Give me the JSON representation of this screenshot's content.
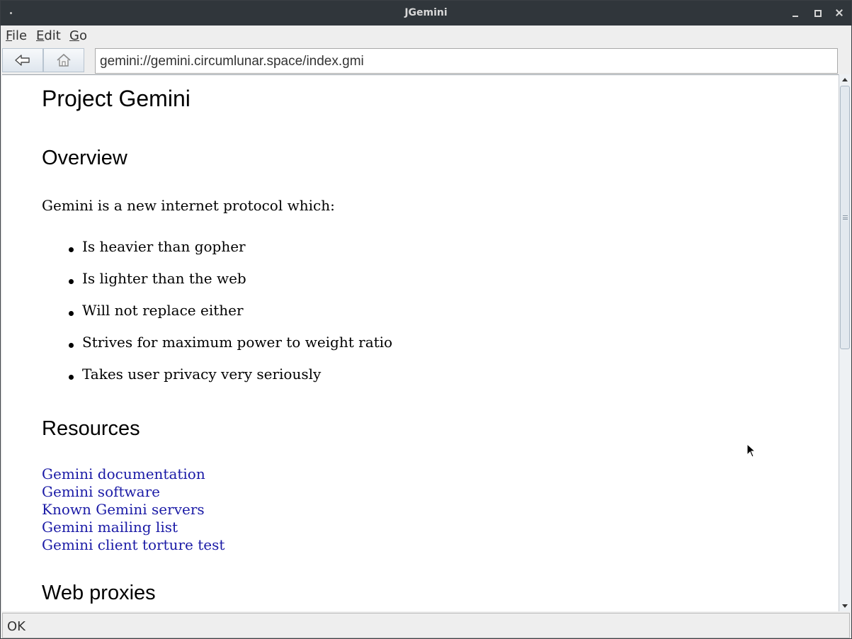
{
  "window": {
    "title": "JGemini"
  },
  "menu": {
    "file_mnemonic": "F",
    "file_rest": "ile",
    "edit_mnemonic": "E",
    "edit_rest": "dit",
    "go_mnemonic": "G",
    "go_rest": "o"
  },
  "toolbar": {
    "back_icon": "back-arrow-icon",
    "home_icon": "home-icon",
    "address_value": "gemini://gemini.circumlunar.space/index.gmi"
  },
  "page": {
    "title": "Project Gemini",
    "overview_heading": "Overview",
    "intro": "Gemini is a new internet protocol which:",
    "bullets": [
      "Is heavier than gopher",
      "Is lighter than the web",
      "Will not replace either",
      "Strives for maximum power to weight ratio",
      "Takes user privacy very seriously"
    ],
    "resources_heading": "Resources",
    "links": [
      "Gemini documentation",
      "Gemini software",
      "Known Gemini servers",
      "Gemini mailing list",
      "Gemini client torture test"
    ],
    "proxies_heading": "Web proxies"
  },
  "status": {
    "text": "OK"
  },
  "colors": {
    "title_bar": "#30363b",
    "link": "#1a1aa6",
    "chrome": "#eeeeee"
  }
}
